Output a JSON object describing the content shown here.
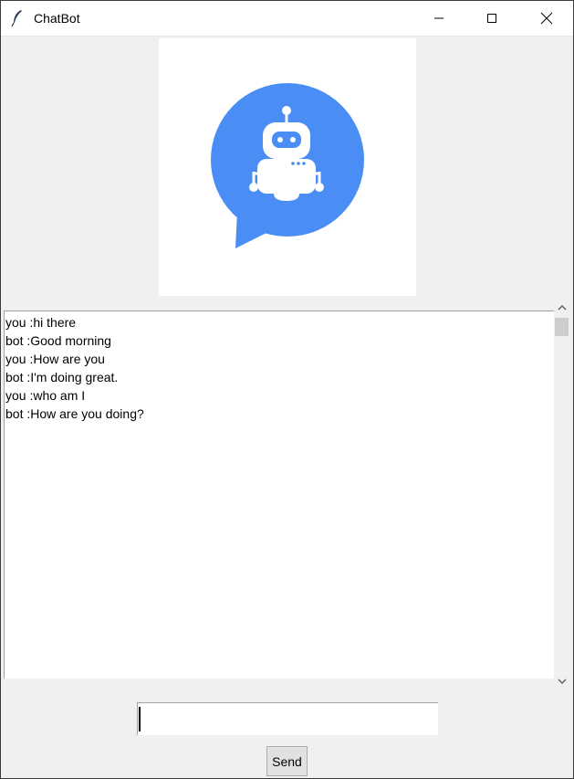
{
  "window": {
    "title": "ChatBot"
  },
  "logo": {
    "icon": "chatbot-robot-icon",
    "accent_color": "#4a8ef5"
  },
  "chat": {
    "messages": [
      "you :hi there",
      "bot :Good morning",
      "you :How are you",
      "bot :I'm doing great.",
      "you :who am I",
      "bot :How are you doing?"
    ]
  },
  "input": {
    "value": "",
    "placeholder": ""
  },
  "send_button": {
    "label": "Send"
  }
}
